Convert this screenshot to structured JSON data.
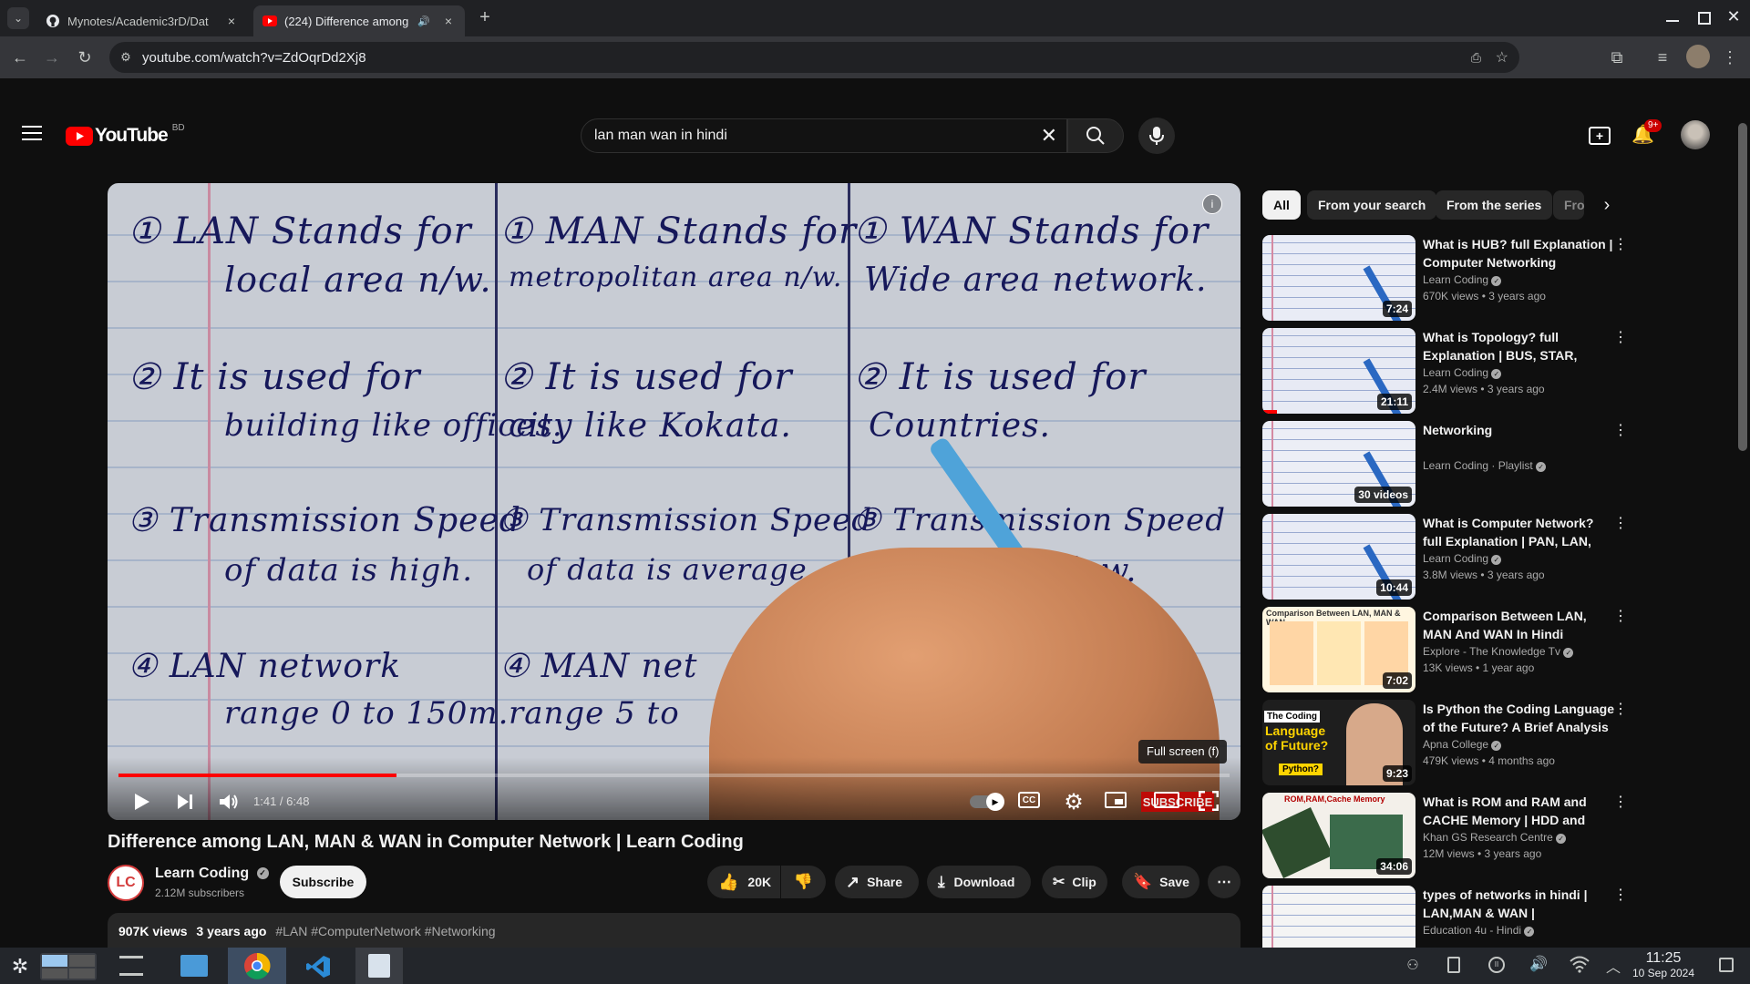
{
  "browser": {
    "tabs": [
      {
        "title": "Mynotes/Academic3rD/Dat",
        "close": "×"
      },
      {
        "title": "(224) Difference among",
        "close": "×"
      }
    ],
    "new_tab": "+",
    "url": "youtube.com/watch?v=ZdOqrDd2Xj8"
  },
  "youtube": {
    "logo_text": "YouTube",
    "country": "BD",
    "search_value": "lan man wan in hindi",
    "notifications_badge": "9+"
  },
  "video": {
    "board": {
      "col1": [
        "① LAN Stands for",
        "local area n/w.",
        "② It is used for",
        "building like offices.",
        "③ Transmission Speed",
        "of data is high.",
        "④ LAN network",
        "range 0 to 150m."
      ],
      "col2": [
        "① MAN Stands for",
        "metropolitan area n/w.",
        "② It is used for",
        "city like Kokata.",
        "③ Transmission Speed",
        "of data is average.",
        "④ MAN net",
        "range 5 to"
      ],
      "col3": [
        "① WAN Stands for",
        "Wide area network.",
        "② It is used for",
        "Countries.",
        "③ Transmission Speed",
        "is low."
      ]
    },
    "time_current": "1:41",
    "time_total": "6:48",
    "progress": 0.25,
    "tooltip": "Full screen (f)",
    "subscribe_watermark": "SUBSCRIBE",
    "title": "Difference among LAN, MAN & WAN in Computer Network | Learn Coding"
  },
  "channel": {
    "avatar_text": "LC",
    "name": "Learn Coding",
    "subscribers": "2.12M subscribers",
    "subscribe_label": "Subscribe"
  },
  "actions": {
    "likes": "20K",
    "share": "Share",
    "download": "Download",
    "clip": "Clip",
    "save": "Save"
  },
  "description": {
    "views": "907K views",
    "age": "3 years ago",
    "hashtags": "#LAN #ComputerNetwork #Networking"
  },
  "chips": [
    "All",
    "From your search",
    "From the series",
    "Fro"
  ],
  "recommendations": [
    {
      "title": "What is HUB? full Explanation | Computer Networking",
      "channel": "Learn Coding",
      "meta": "670K views • 3 years ago",
      "duration": "7:24",
      "thumb_color": "#e9ecf6"
    },
    {
      "title": "What is Topology? full Explanation | BUS, STAR, RING...",
      "channel": "Learn Coding",
      "meta": "2.4M views • 3 years ago",
      "duration": "21:11",
      "thumb_color": "#e7eaf4"
    },
    {
      "title": "Networking",
      "channel": "Learn Coding · Playlist",
      "meta": "",
      "duration": "30 videos",
      "thumb_color": "#eceef6"
    },
    {
      "title": "What is Computer Network? full Explanation | PAN, LAN, MAN...",
      "channel": "Learn Coding",
      "meta": "3.8M views • 3 years ago",
      "duration": "10:44",
      "thumb_color": "#e8ebf5"
    },
    {
      "title": "Comparison Between LAN, MAN And WAN In Hindi",
      "channel": "Explore - The Knowledge Tv",
      "meta": "13K views • 1 year ago",
      "duration": "7:02",
      "thumb_color": "#fff6e0"
    },
    {
      "title": "Is Python the Coding Language of the Future? A Brief Analysis",
      "channel": "Apna College",
      "meta": "479K views • 4 months ago",
      "duration": "9:23",
      "thumb_color": "#1e1e1e"
    },
    {
      "title": "What is ROM and RAM and CACHE Memory | HDD and SS...",
      "channel": "Khan GS Research Centre",
      "meta": "12M views • 3 years ago",
      "duration": "34:06",
      "thumb_color": "#f3f0ea"
    },
    {
      "title": "types of networks in hindi | LAN,MAN & WAN | Networking...",
      "channel": "Education 4u - Hindi",
      "meta": "",
      "duration": "",
      "thumb_color": "#f4f4f4"
    }
  ],
  "thumb_texts": {
    "python_1": "The Coding",
    "python_2": "Language of Future?",
    "python_3": "Python?",
    "rom": "ROM,RAM,Cache Memory",
    "cmp": "Comparison Between LAN, MAN & WAN"
  },
  "taskbar": {
    "time": "11:25",
    "date": "10 Sep 2024"
  },
  "colors": {
    "yt_red": "#ff0000",
    "bg": "#0f0f0f",
    "chip_active": "#f1f1f1"
  }
}
